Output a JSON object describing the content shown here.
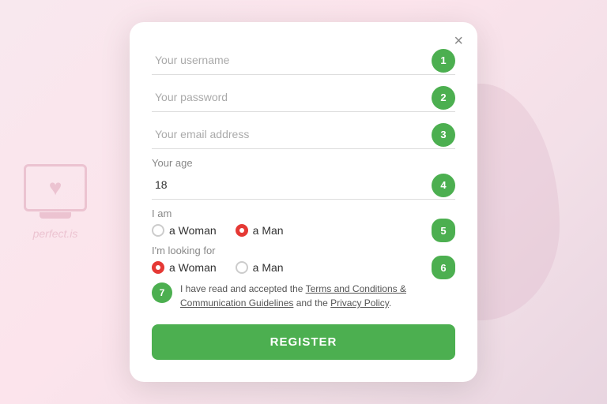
{
  "watermark": {
    "site": "perfect.is"
  },
  "modal": {
    "close_label": "×",
    "fields": [
      {
        "id": "username",
        "placeholder": "Your username",
        "step": "1",
        "type": "text"
      },
      {
        "id": "password",
        "placeholder": "Your password",
        "step": "2",
        "type": "password"
      },
      {
        "id": "email",
        "placeholder": "Your email address",
        "step": "3",
        "type": "email"
      }
    ],
    "age": {
      "label": "Your age",
      "value": "18",
      "step": "4"
    },
    "iam": {
      "label": "I am",
      "step": "5",
      "options": [
        {
          "value": "woman",
          "label": "a Woman",
          "selected": false
        },
        {
          "value": "man",
          "label": "a Man",
          "selected": true
        }
      ]
    },
    "looking_for": {
      "label": "I'm looking for",
      "step": "6",
      "options": [
        {
          "value": "woman",
          "label": "a Woman",
          "selected": true
        },
        {
          "value": "man",
          "label": "a Man",
          "selected": false
        }
      ]
    },
    "terms": {
      "step": "7",
      "text_before": "I have read and accepted the ",
      "link1": "Terms and Conditions & Communication Guidelines",
      "text_between": " and the ",
      "link2": "Privacy Policy",
      "text_after": "."
    },
    "register_label": "REGISTER"
  }
}
